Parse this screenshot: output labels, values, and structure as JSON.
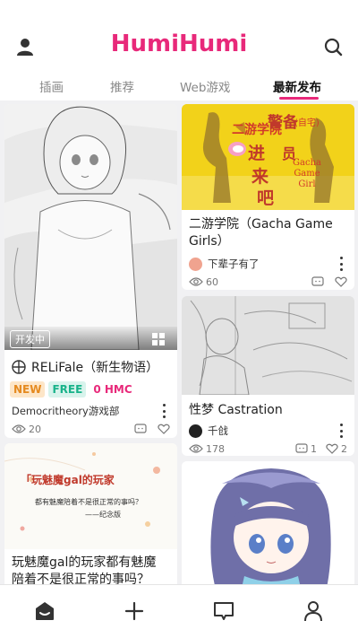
{
  "header": {
    "logo_text": "HumiHumi"
  },
  "tabs": [
    {
      "label": "插画"
    },
    {
      "label": "推荐"
    },
    {
      "label": "Web游戏"
    },
    {
      "label": "最新发布"
    }
  ],
  "cards": {
    "relifale": {
      "overlay_label": "开发中",
      "title": "RELiFale（新生物语）",
      "badges": [
        "NEW",
        "FREE",
        "0 HMC"
      ],
      "author": "Democritheory游戏部",
      "views": "20",
      "comments": "",
      "likes": ""
    },
    "gacha": {
      "image_text_1": "二游学院",
      "image_text_2": "警备",
      "image_text_3": "进",
      "image_text_4": "员",
      "image_text_5": "来",
      "image_text_6": "吧",
      "image_text_7": "(自宅)",
      "image_text_8": "Gacha Game Girl",
      "title_line1": "二游学院（Gacha Game",
      "title_line2": "Girls）",
      "author": "下辈子有了",
      "views": "60"
    },
    "castration": {
      "title": "性梦 Castration",
      "author": "千戗",
      "views": "178",
      "comments": "1",
      "likes": "2"
    },
    "mamo": {
      "image_text_1": "「玩魅魔gal的玩家",
      "image_text_2": "都有魅魔陪着不是很正常的事吗？",
      "image_text_3": "——纪念版",
      "title_line1": "玩魅魔gal的玩家都有魅魔",
      "title_line2": "陪着不是很正常的事吗？"
    }
  },
  "bottom_nav": [
    {
      "name": "home"
    },
    {
      "name": "create"
    },
    {
      "name": "messages"
    },
    {
      "name": "profile"
    }
  ],
  "colors": {
    "brand": "#e8297a",
    "badge_new_bg": "#fde6c8",
    "badge_new_fg": "#e58a1f",
    "badge_free_bg": "#d8f3ec",
    "badge_free_fg": "#19b38a",
    "badge_hmc_fg": "#e8297a"
  }
}
